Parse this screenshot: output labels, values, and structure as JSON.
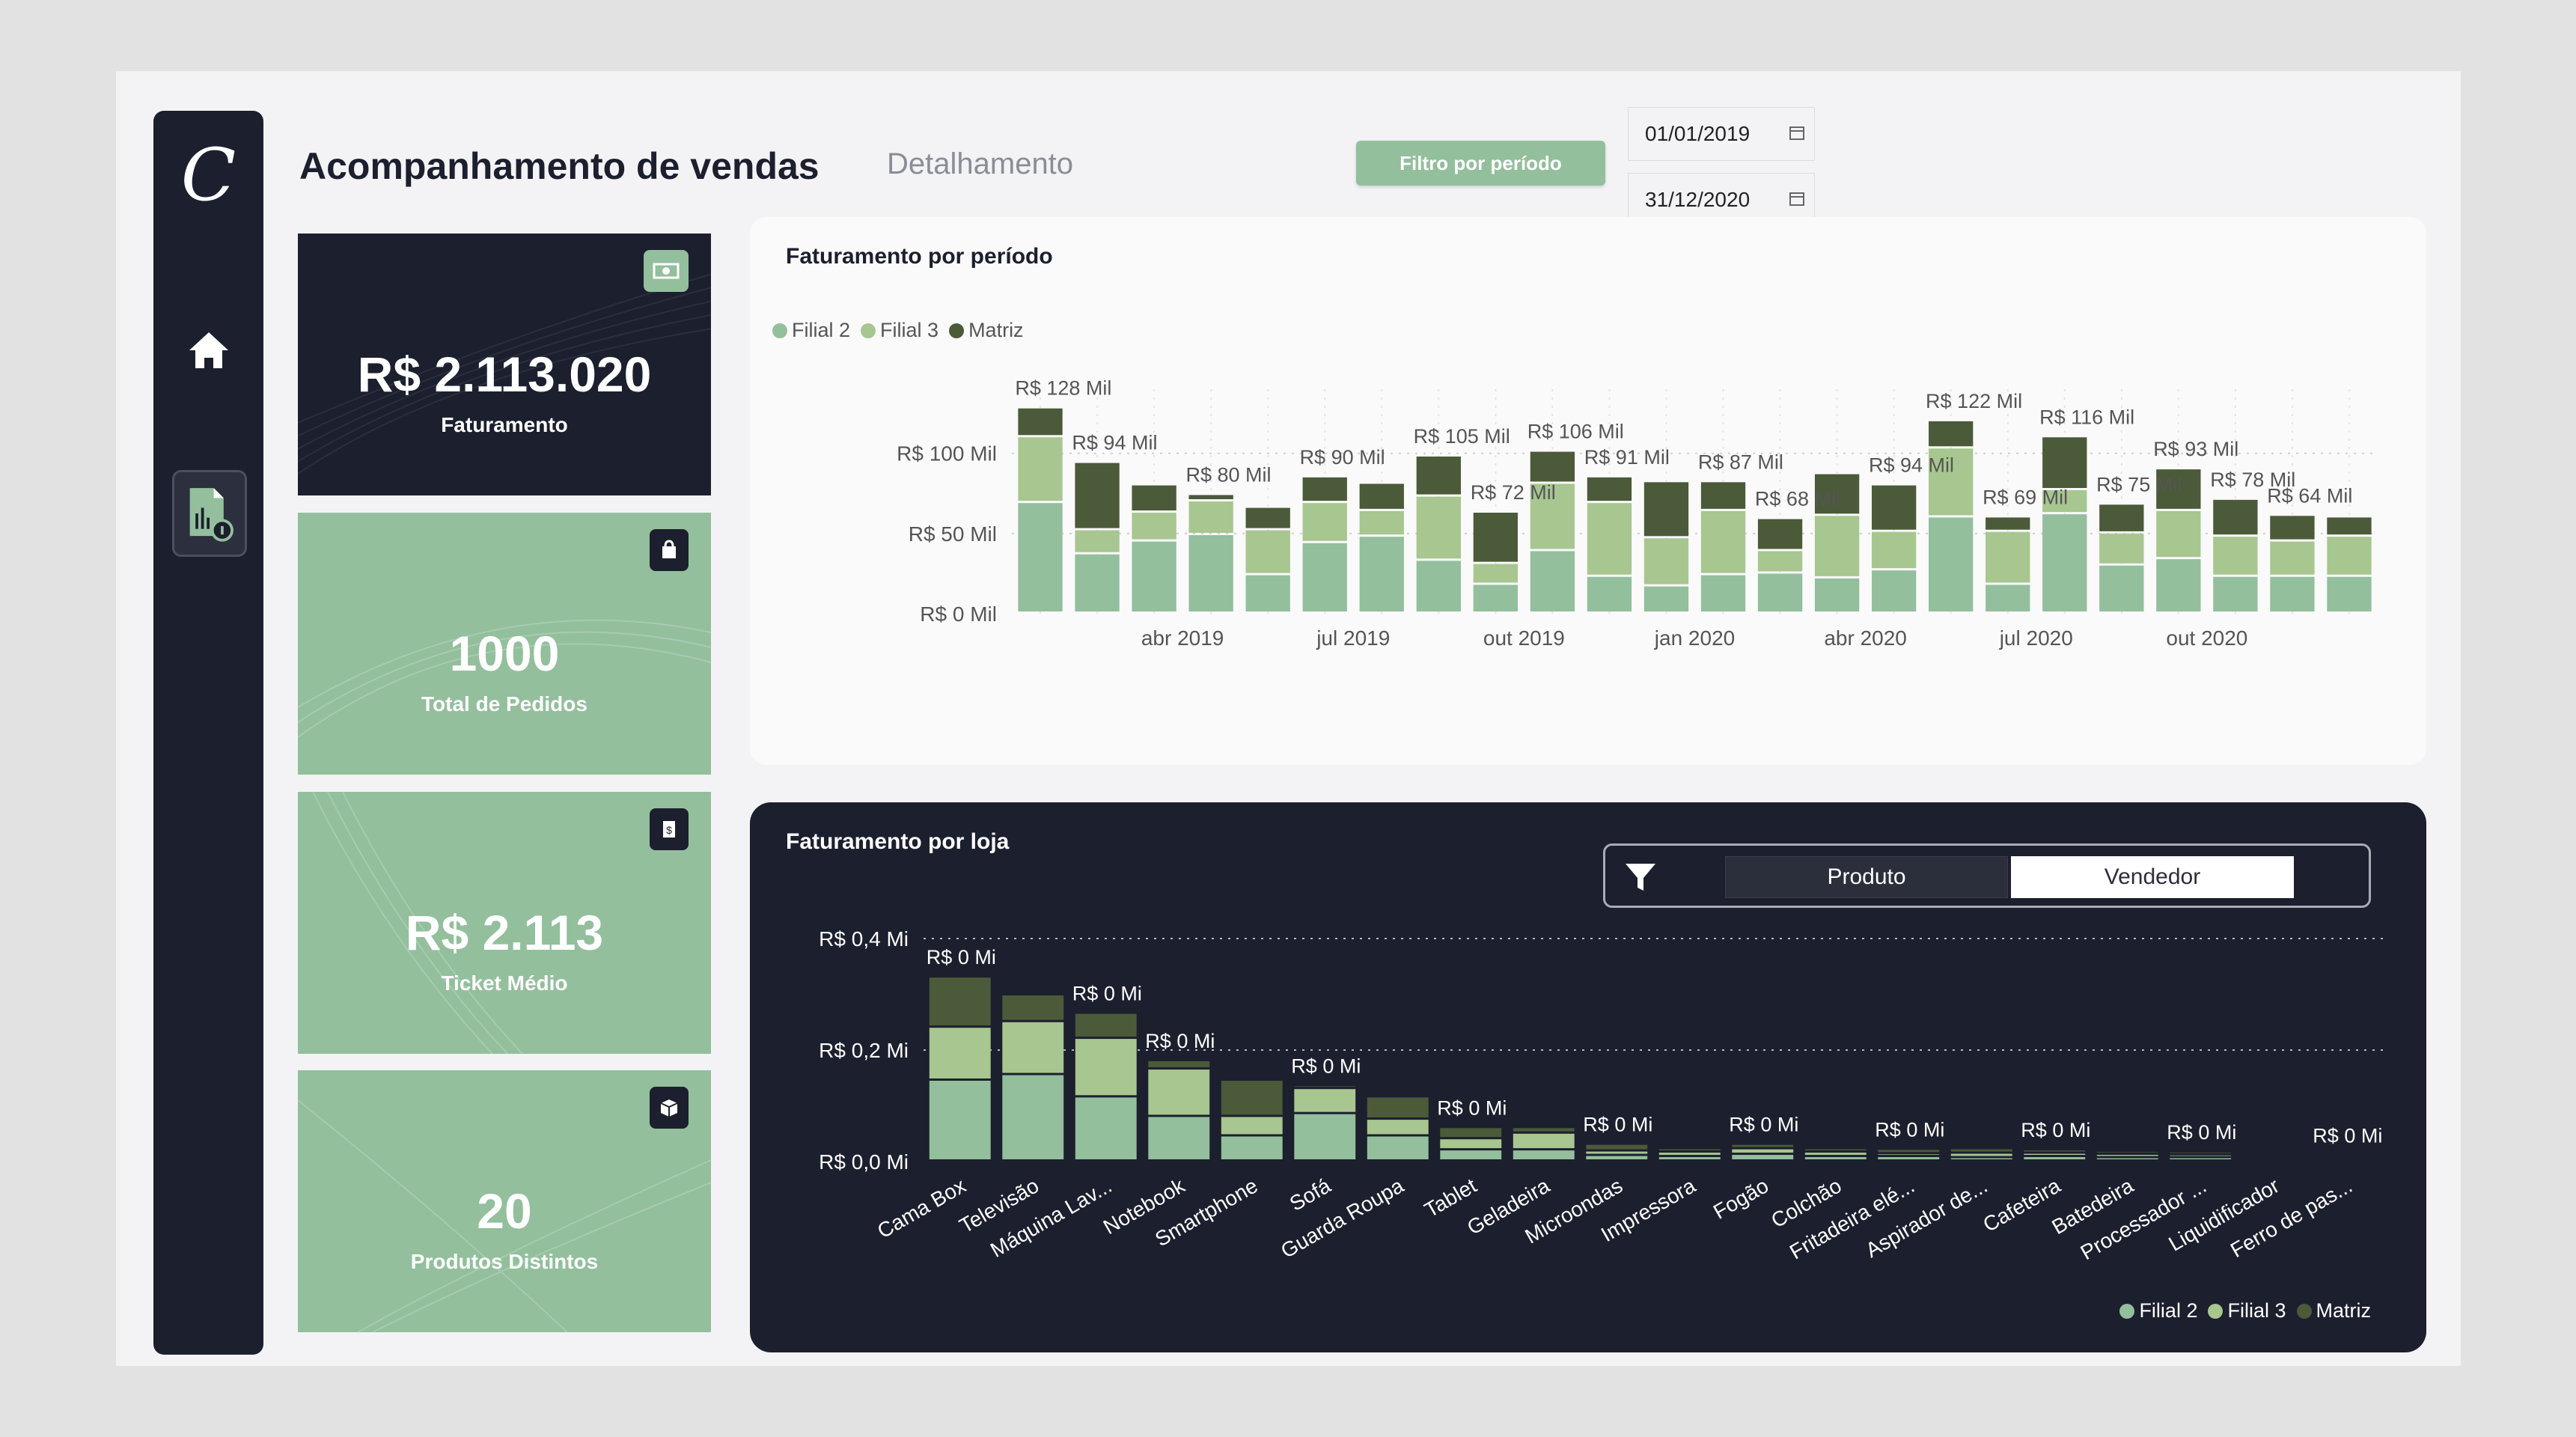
{
  "header": {
    "logo": "C",
    "title": "Acompanhamento de vendas",
    "subtitle": "Detalhamento",
    "filter_label": "Filtro por período",
    "date_start": "01/01/2019",
    "date_end": "31/12/2020"
  },
  "kpis": [
    {
      "value": "R$ 2.113.020",
      "label": "Faturamento",
      "icon": "money-icon"
    },
    {
      "value": "1000",
      "label": "Total de Pedidos",
      "icon": "shopping-bag-icon"
    },
    {
      "value": "R$ 2.113",
      "label": "Ticket Médio",
      "icon": "receipt-icon"
    },
    {
      "value": "20",
      "label": "Produtos Distintos",
      "icon": "box-icon"
    }
  ],
  "colors": {
    "filial2": "#93bf9c",
    "filial3": "#a7c690",
    "matriz": "#4b5a38",
    "dark": "#1c1f2e",
    "accent": "#93bf9c"
  },
  "period_chart": {
    "title": "Faturamento por período",
    "legend": [
      "Filial 2",
      "Filial 3",
      "Matriz"
    ]
  },
  "store_chart": {
    "title": "Faturamento por loja",
    "legend": [
      "Filial 2",
      "Filial 3",
      "Matriz"
    ],
    "toggle": {
      "option_a": "Produto",
      "option_b": "Vendedor"
    }
  },
  "chart_data": [
    {
      "type": "bar",
      "stacked": true,
      "title": "Faturamento por período",
      "ylim": [
        0,
        140
      ],
      "yticks": [
        "R$ 0 Mil",
        "R$ 50 Mil",
        "R$ 100 Mil"
      ],
      "ytick_values": [
        0,
        50,
        100
      ],
      "xticks": [
        "abr 2019",
        "jul 2019",
        "out 2019",
        "jan 2020",
        "abr 2020",
        "jul 2020",
        "out 2020"
      ],
      "xtick_index": [
        3,
        6,
        9,
        12,
        15,
        18,
        21
      ],
      "grid": true,
      "legend_position": "top-left",
      "categories": [
        "jan 2019",
        "fev 2019",
        "mar 2019",
        "abr 2019",
        "mai 2019",
        "jun 2019",
        "jul 2019",
        "ago 2019",
        "set 2019",
        "out 2019",
        "nov 2019",
        "dez 2019",
        "jan 2020",
        "fev 2020",
        "mar 2020",
        "abr 2020",
        "mai 2020",
        "jun 2020",
        "jul 2020",
        "ago 2020",
        "set 2020",
        "out 2020",
        "nov 2020",
        "dez 2020"
      ],
      "series": [
        {
          "name": "Filial 2",
          "values": [
            69,
            37,
            45,
            49,
            24,
            44,
            48,
            33,
            18,
            39,
            23,
            17,
            24,
            25,
            22,
            27,
            60,
            18,
            62,
            30,
            34,
            23,
            23,
            23
          ]
        },
        {
          "name": "Filial 3",
          "values": [
            41,
            15,
            18,
            21,
            28,
            25,
            16,
            40,
            13,
            42,
            46,
            30,
            40,
            14,
            39,
            24,
            43,
            33,
            15,
            20,
            30,
            25,
            22,
            25
          ]
        },
        {
          "name": "Matriz",
          "values": [
            18,
            42,
            17,
            4,
            14,
            16,
            17,
            25,
            32,
            20,
            16,
            35,
            18,
            20,
            26,
            29,
            17,
            9,
            33,
            18,
            26,
            23,
            16,
            12
          ]
        }
      ],
      "data_labels": [
        {
          "index": 0,
          "text": "R$ 128 Mil"
        },
        {
          "index": 1,
          "text": "R$ 94 Mil"
        },
        {
          "index": 3,
          "text": "R$ 80 Mil"
        },
        {
          "index": 5,
          "text": "R$ 90 Mil"
        },
        {
          "index": 7,
          "text": "R$ 105 Mil"
        },
        {
          "index": 8,
          "text": "R$ 72 Mil"
        },
        {
          "index": 9,
          "text": "R$ 106 Mil"
        },
        {
          "index": 10,
          "text": "R$ 91 Mil"
        },
        {
          "index": 12,
          "text": "R$ 87 Mil"
        },
        {
          "index": 13,
          "text": "R$ 68 Mil"
        },
        {
          "index": 15,
          "text": "R$ 94 Mil"
        },
        {
          "index": 16,
          "text": "R$ 122 Mil"
        },
        {
          "index": 17,
          "text": "R$ 69 Mil"
        },
        {
          "index": 18,
          "text": "R$ 116 Mil"
        },
        {
          "index": 19,
          "text": "R$ 75 Mil"
        },
        {
          "index": 20,
          "text": "R$ 93 Mil"
        },
        {
          "index": 21,
          "text": "R$ 78 Mil"
        },
        {
          "index": 22,
          "text": "R$ 64 Mil"
        }
      ]
    },
    {
      "type": "bar",
      "stacked": true,
      "title": "Faturamento por loja",
      "ylim": [
        0,
        0.4
      ],
      "yticks": [
        "R$ 0,0 Mi",
        "R$ 0,2 Mi",
        "R$ 0,4 Mi"
      ],
      "ytick_values": [
        0,
        0.2,
        0.4
      ],
      "grid": true,
      "legend_position": "bottom-right",
      "categories": [
        "Cama Box",
        "Televisão",
        "Máquina Lav...",
        "Notebook",
        "Smartphone",
        "Sofá",
        "Guarda Roupa",
        "Tablet",
        "Geladeira",
        "Microondas",
        "Impressora",
        "Fogão",
        "Colchão",
        "Fritadeira elé...",
        "Aspirador de...",
        "Cafeteira",
        "Batedeira",
        "Processador ...",
        "Liquidificador",
        "Ferro de pas..."
      ],
      "series": [
        {
          "name": "Filial 2",
          "values": [
            0.145,
            0.155,
            0.115,
            0.08,
            0.045,
            0.085,
            0.045,
            0.02,
            0.02,
            0.01,
            0.008,
            0.012,
            0.008,
            0.008,
            0.006,
            0.008,
            0.006,
            0.006,
            0.004,
            0.004
          ]
        },
        {
          "name": "Filial 3",
          "values": [
            0.095,
            0.095,
            0.105,
            0.085,
            0.035,
            0.045,
            0.03,
            0.02,
            0.03,
            0.008,
            0.008,
            0.01,
            0.008,
            0.005,
            0.008,
            0.006,
            0.006,
            0.005,
            0.004,
            0.003
          ]
        },
        {
          "name": "Matriz",
          "values": [
            0.09,
            0.048,
            0.045,
            0.015,
            0.065,
            0.005,
            0.04,
            0.02,
            0.01,
            0.012,
            0.006,
            0.008,
            0.006,
            0.008,
            0.008,
            0.006,
            0.005,
            0.005,
            0.004,
            0.003
          ]
        }
      ],
      "data_labels": [
        {
          "index": 0,
          "text": "R$ 0 Mi"
        },
        {
          "index": 2,
          "text": "R$ 0 Mi"
        },
        {
          "index": 3,
          "text": "R$ 0 Mi"
        },
        {
          "index": 5,
          "text": "R$ 0 Mi"
        },
        {
          "index": 7,
          "text": "R$ 0 Mi"
        },
        {
          "index": 9,
          "text": "R$ 0 Mi"
        },
        {
          "index": 11,
          "text": "R$ 0 Mi"
        },
        {
          "index": 13,
          "text": "R$ 0 Mi"
        },
        {
          "index": 15,
          "text": "R$ 0 Mi"
        },
        {
          "index": 17,
          "text": "R$ 0 Mi"
        },
        {
          "index": 19,
          "text": "R$ 0 Mi"
        }
      ]
    }
  ]
}
